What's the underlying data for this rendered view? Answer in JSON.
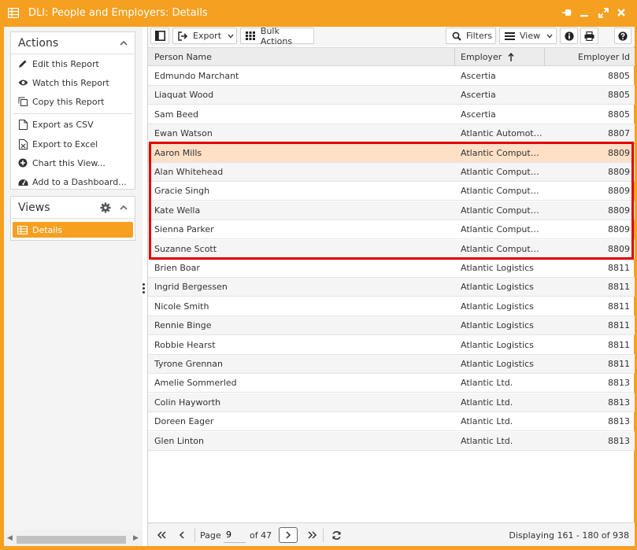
{
  "window": {
    "title": "DLI: People and Employers: Details",
    "colors": {
      "accent": "#f5a020",
      "selected_row": "#fde0c6",
      "highlight_border": "#e00000"
    }
  },
  "sidebar": {
    "actions_title": "Actions",
    "actions": [
      {
        "label": "Edit this Report",
        "icon": "pencil-icon"
      },
      {
        "label": "Watch this Report",
        "icon": "eye-icon"
      },
      {
        "label": "Copy this Report",
        "icon": "copy-icon"
      },
      {
        "label": "Export as CSV",
        "icon": "file-csv-icon"
      },
      {
        "label": "Export to Excel",
        "icon": "file-excel-icon"
      },
      {
        "label": "Chart this View...",
        "icon": "plus-circle-icon"
      },
      {
        "label": "Add to a Dashboard...",
        "icon": "dashboard-icon"
      }
    ],
    "views_title": "Views",
    "views": [
      {
        "label": "Details",
        "icon": "table-icon",
        "selected": true
      }
    ]
  },
  "toolbar": {
    "export_label": "Export",
    "bulk_actions_label": "Bulk Actions",
    "filters_label": "Filters",
    "view_label": "View"
  },
  "grid": {
    "columns": [
      "Person Name",
      "Employer",
      "Employer Id"
    ],
    "sort": {
      "column": "Employer",
      "direction": "ascending"
    },
    "rows": [
      {
        "name": "Edmundo Marchant",
        "employer": "Ascertia",
        "id": "8805"
      },
      {
        "name": "Liaquat Wood",
        "employer": "Ascertia",
        "id": "8805"
      },
      {
        "name": "Sam Beed",
        "employer": "Ascertia",
        "id": "8805"
      },
      {
        "name": "Ewan Watson",
        "employer": "Atlantic Automotive",
        "id": "8807"
      },
      {
        "name": "Aaron Mills",
        "employer": "Atlantic Computer Systems",
        "id": "8809"
      },
      {
        "name": "Alan Whitehead",
        "employer": "Atlantic Computer Systems",
        "id": "8809"
      },
      {
        "name": "Gracie Singh",
        "employer": "Atlantic Computer Systems",
        "id": "8809"
      },
      {
        "name": "Kate Wella",
        "employer": "Atlantic Computer Systems",
        "id": "8809"
      },
      {
        "name": "Sienna Parker",
        "employer": "Atlantic Computer Systems",
        "id": "8809"
      },
      {
        "name": "Suzanne Scott",
        "employer": "Atlantic Computer Systems",
        "id": "8809"
      },
      {
        "name": "Brien Boar",
        "employer": "Atlantic Logistics",
        "id": "8811"
      },
      {
        "name": "Ingrid Bergessen",
        "employer": "Atlantic Logistics",
        "id": "8811"
      },
      {
        "name": "Nicole Smith",
        "employer": "Atlantic Logistics",
        "id": "8811"
      },
      {
        "name": "Rennie Binge",
        "employer": "Atlantic Logistics",
        "id": "8811"
      },
      {
        "name": "Robbie Hearst",
        "employer": "Atlantic Logistics",
        "id": "8811"
      },
      {
        "name": "Tyrone Grennan",
        "employer": "Atlantic Logistics",
        "id": "8811"
      },
      {
        "name": "Amelie Sommerled",
        "employer": "Atlantic Ltd.",
        "id": "8813"
      },
      {
        "name": "Colin Hayworth",
        "employer": "Atlantic Ltd.",
        "id": "8813"
      },
      {
        "name": "Doreen Eager",
        "employer": "Atlantic Ltd.",
        "id": "8813"
      },
      {
        "name": "Glen Linton",
        "employer": "Atlantic Ltd.",
        "id": "8813"
      }
    ],
    "selected_row": 4
  },
  "pager": {
    "page_label": "Page",
    "page_value": "9",
    "of_label": "of 47",
    "displaying": "Displaying 161 - 180 of 938"
  }
}
